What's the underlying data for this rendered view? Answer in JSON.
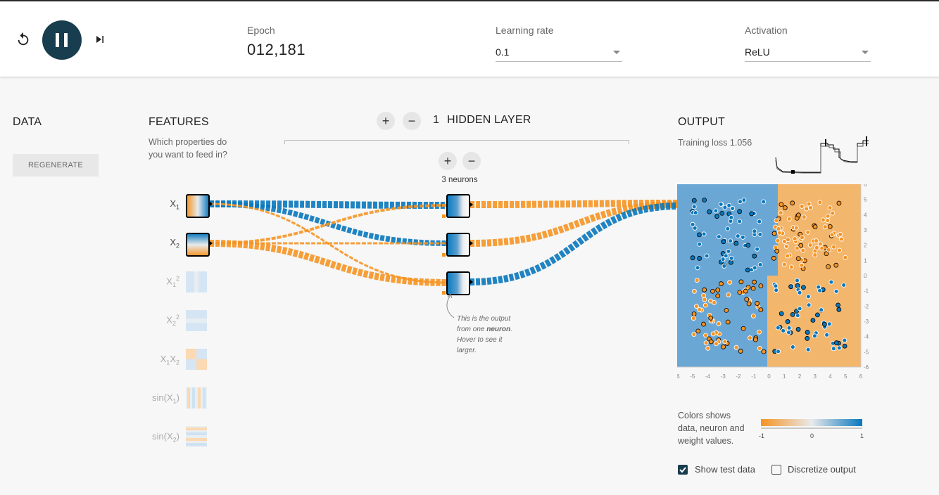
{
  "controls": {
    "reset_icon": "reset-icon",
    "play_icon": "pause-icon",
    "step_icon": "step-icon"
  },
  "epoch": {
    "label": "Epoch",
    "value": "012,181"
  },
  "learning_rate": {
    "label": "Learning rate",
    "value": "0.1"
  },
  "activation": {
    "label": "Activation",
    "value": "ReLU"
  },
  "data_section": {
    "title": "DATA",
    "regenerate_label": "REGENERATE"
  },
  "features_section": {
    "title": "FEATURES",
    "subtitle_line1": "Which properties do",
    "subtitle_line2": "you want to feed in?",
    "features": [
      {
        "label": "X",
        "sub": "1",
        "sup": "",
        "active": true
      },
      {
        "label": "X",
        "sub": "2",
        "sup": "",
        "active": true
      },
      {
        "label": "X",
        "sub": "1",
        "sup": "2",
        "active": false
      },
      {
        "label": "X",
        "sub": "2",
        "sup": "2",
        "active": false
      },
      {
        "label": "X1X2",
        "sub": "",
        "sup": "",
        "active": false
      },
      {
        "label": "sin(X1)",
        "sub": "",
        "sup": "",
        "active": false
      },
      {
        "label": "sin(X2)",
        "sub": "",
        "sup": "",
        "active": false
      }
    ]
  },
  "hidden": {
    "count": "1",
    "title": "HIDDEN LAYER",
    "neurons_label": "3 neurons",
    "add": "+",
    "remove": "−"
  },
  "neuron_note": {
    "line1": "This is the output",
    "line2_pre": "from one ",
    "line2_bold": "neuron",
    "line2_post": ".",
    "line3": "Hover to see it",
    "line4": "larger."
  },
  "output": {
    "title": "OUTPUT",
    "training_loss_label": "Training loss",
    "training_loss_value": "1.056",
    "y_ticks": [
      "6",
      "5",
      "4",
      "3",
      "2",
      "1",
      "0",
      "-1",
      "-2",
      "-3",
      "-4",
      "-5",
      "-6"
    ],
    "x_ticks": [
      "-6",
      "-5",
      "-4",
      "-3",
      "-2",
      "-1",
      "0",
      "1",
      "2",
      "3",
      "4",
      "5",
      "6"
    ]
  },
  "legend": {
    "line1": "Colors shows",
    "line2": "data, neuron and",
    "line3": "weight values.",
    "min": "-1",
    "mid": "0",
    "max": "1"
  },
  "options": {
    "show_test_label": "Show test data",
    "show_test_checked": true,
    "discretize_label": "Discretize output",
    "discretize_checked": false
  },
  "colors": {
    "orange": "#f59322",
    "blue": "#0877bd",
    "dark": "#183d4e"
  }
}
